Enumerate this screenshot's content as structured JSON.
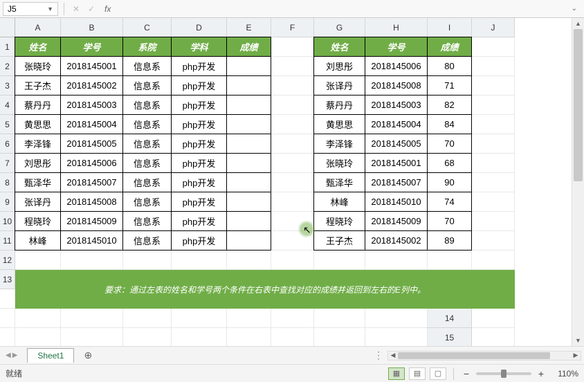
{
  "name_box": {
    "ref": "J5"
  },
  "formula_bar": {
    "fx": "fx",
    "value": ""
  },
  "columns": [
    "A",
    "B",
    "C",
    "D",
    "E",
    "F",
    "G",
    "H",
    "I",
    "J"
  ],
  "rows": [
    "1",
    "2",
    "3",
    "4",
    "5",
    "6",
    "7",
    "8",
    "9",
    "10",
    "11",
    "12",
    "13",
    "14",
    "15"
  ],
  "left_headers": {
    "name": "姓名",
    "id": "学号",
    "dept": "系院",
    "subject": "学科",
    "score": "成绩"
  },
  "right_headers": {
    "name": "姓名",
    "id": "学号",
    "score": "成绩"
  },
  "left_table": [
    {
      "name": "张晓玲",
      "id": "2018145001",
      "dept": "信息系",
      "subject": "php开发",
      "score": ""
    },
    {
      "name": "王子杰",
      "id": "2018145002",
      "dept": "信息系",
      "subject": "php开发",
      "score": ""
    },
    {
      "name": "蔡丹丹",
      "id": "2018145003",
      "dept": "信息系",
      "subject": "php开发",
      "score": ""
    },
    {
      "name": "黄思思",
      "id": "2018145004",
      "dept": "信息系",
      "subject": "php开发",
      "score": ""
    },
    {
      "name": "李泽锋",
      "id": "2018145005",
      "dept": "信息系",
      "subject": "php开发",
      "score": ""
    },
    {
      "name": "刘思彤",
      "id": "2018145006",
      "dept": "信息系",
      "subject": "php开发",
      "score": ""
    },
    {
      "name": "甄泽华",
      "id": "2018145007",
      "dept": "信息系",
      "subject": "php开发",
      "score": ""
    },
    {
      "name": "张译丹",
      "id": "2018145008",
      "dept": "信息系",
      "subject": "php开发",
      "score": ""
    },
    {
      "name": "程晓玲",
      "id": "2018145009",
      "dept": "信息系",
      "subject": "php开发",
      "score": ""
    },
    {
      "name": "林峰",
      "id": "2018145010",
      "dept": "信息系",
      "subject": "php开发",
      "score": ""
    }
  ],
  "right_table": [
    {
      "name": "刘思彤",
      "id": "2018145006",
      "score": "80"
    },
    {
      "name": "张译丹",
      "id": "2018145008",
      "score": "71"
    },
    {
      "name": "蔡丹丹",
      "id": "2018145003",
      "score": "82"
    },
    {
      "name": "黄思思",
      "id": "2018145004",
      "score": "84"
    },
    {
      "name": "李泽锋",
      "id": "2018145005",
      "score": "70"
    },
    {
      "name": "张晓玲",
      "id": "2018145001",
      "score": "68"
    },
    {
      "name": "甄泽华",
      "id": "2018145007",
      "score": "90"
    },
    {
      "name": "林峰",
      "id": "2018145010",
      "score": "74"
    },
    {
      "name": "程晓玲",
      "id": "2018145009",
      "score": "70"
    },
    {
      "name": "王子杰",
      "id": "2018145002",
      "score": "89"
    }
  ],
  "note": "要求：通过左表的姓名和学号两个条件在右表中查找对应的成绩并返回到左右的E列中。",
  "sheet_tabs": {
    "active": "Sheet1"
  },
  "status": {
    "ready": "就绪",
    "zoom": "110%"
  }
}
